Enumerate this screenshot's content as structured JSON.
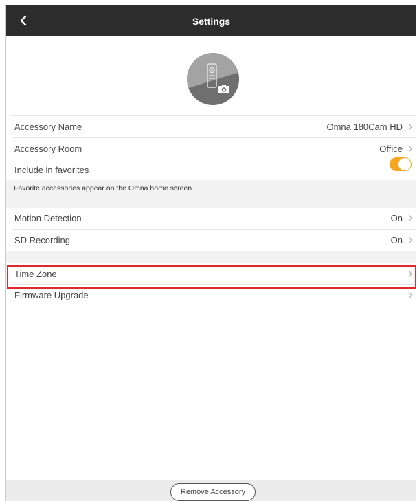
{
  "header": {
    "title": "Settings",
    "back_icon": "chevron-left-icon"
  },
  "device_image": {
    "icon": "camera-device-icon"
  },
  "rows": {
    "accessory_name": {
      "label": "Accessory Name",
      "value": "Omna 180Cam HD"
    },
    "accessory_room": {
      "label": "Accessory Room",
      "value": "Office"
    },
    "favorites": {
      "label": "Include in favorites",
      "enabled": true
    },
    "favorites_note": "Favorite accessories appear on the Omna home screen.",
    "motion_detection": {
      "label": "Motion Detection",
      "value": "On"
    },
    "sd_recording": {
      "label": "SD Recording",
      "value": "On"
    },
    "time_zone": {
      "label": "Time Zone"
    },
    "firmware_upgrade": {
      "label": "Firmware Upgrade"
    }
  },
  "footer": {
    "remove_label": "Remove Accessory"
  },
  "colors": {
    "navbar": "#2d2d2d",
    "toggle_on": "#f5a623",
    "highlight": "#e0282e",
    "section_gap": "#f2f2f2"
  }
}
